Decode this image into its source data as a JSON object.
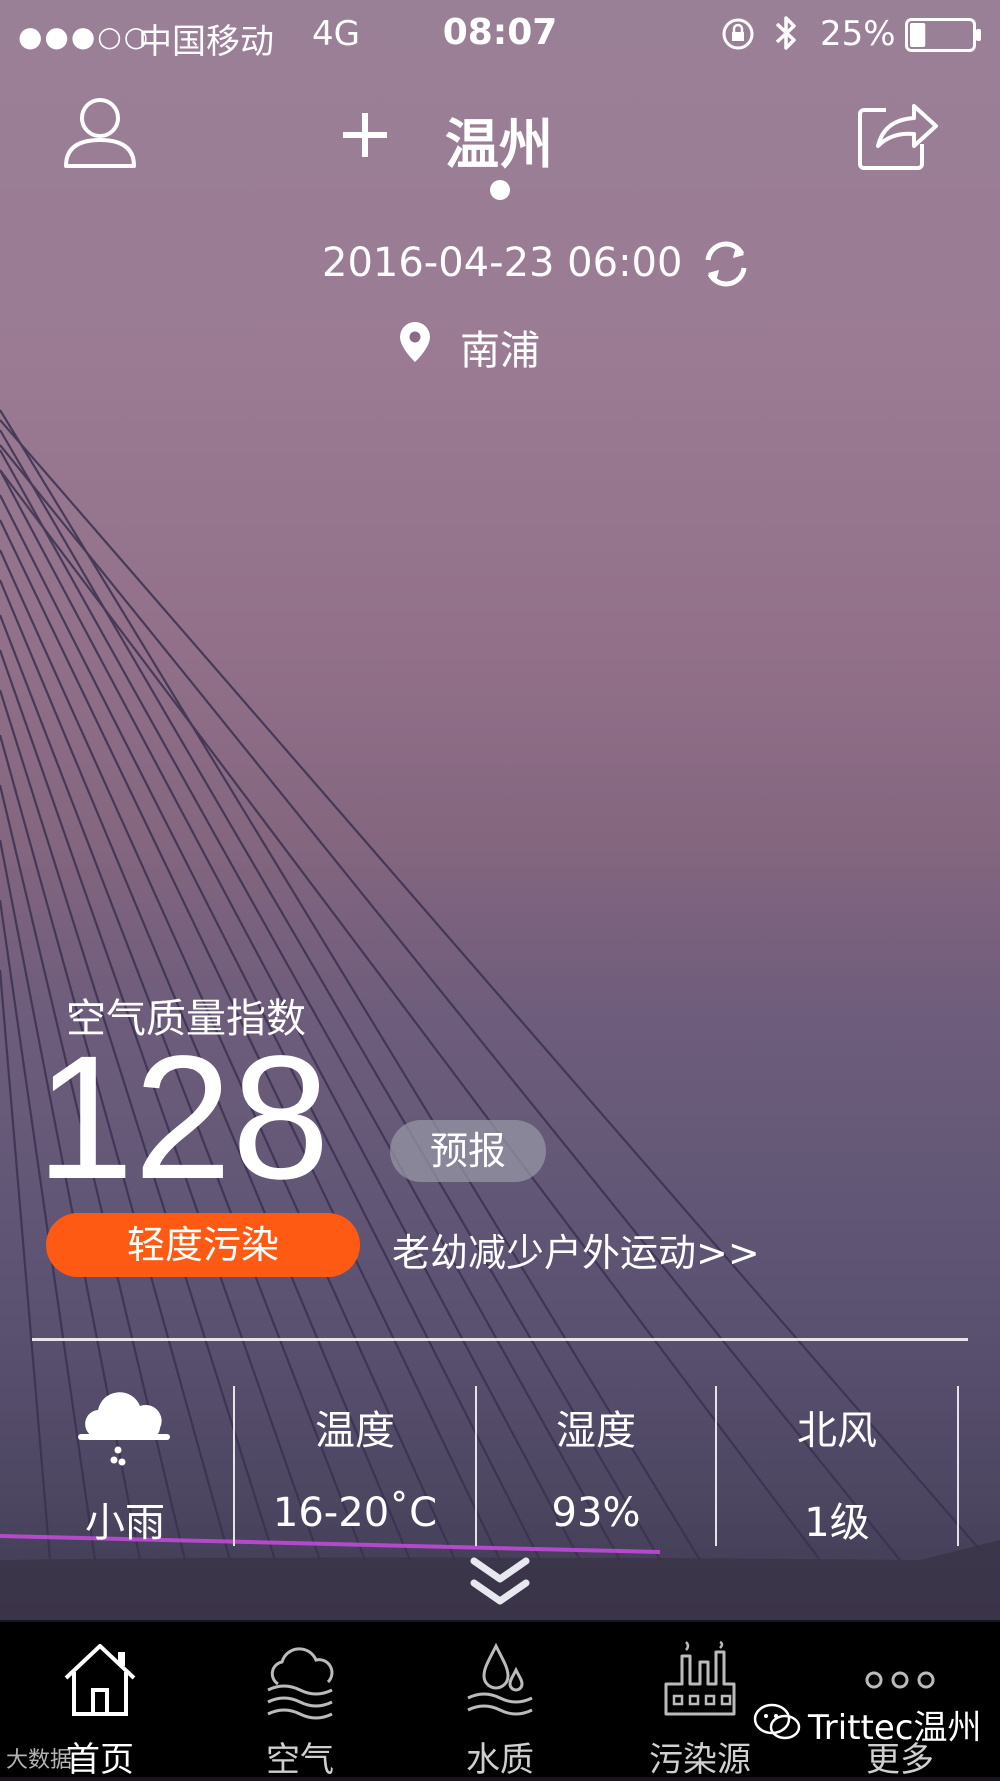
{
  "status_bar": {
    "signal": "●●●○○",
    "carrier": "中国移动",
    "network": "4G",
    "time": "08:07",
    "battery": "25%",
    "battery_level": 0.25
  },
  "header": {
    "city": "温州",
    "timestamp": "2016-04-23 06:00",
    "station": "南浦",
    "icons": [
      "profile-icon",
      "add-icon",
      "share-icon",
      "refresh-icon",
      "location-pin-icon"
    ]
  },
  "aqi": {
    "label": "空气质量指数",
    "value": "128",
    "forecast_label": "预报",
    "level": "轻度污染",
    "level_color": "#ff5a14",
    "advice": "老幼减少户外运动>>"
  },
  "weather": {
    "condition": "小雨",
    "temp_label": "温度",
    "temp_value": "16-20˚C",
    "humidity_label": "湿度",
    "humidity_value": "93%",
    "wind_label": "北风",
    "wind_value": "1级"
  },
  "tabs": [
    {
      "label": "首页",
      "icon": "home-icon",
      "active": true
    },
    {
      "label": "空气",
      "icon": "air-icon",
      "active": false
    },
    {
      "label": "水质",
      "icon": "water-icon",
      "active": false
    },
    {
      "label": "污染源",
      "icon": "factory-icon",
      "active": false
    },
    {
      "label": "更多",
      "icon": "more-icon",
      "active": false
    }
  ],
  "watermark": {
    "text": "Trittec温州",
    "corner": "大数据"
  }
}
